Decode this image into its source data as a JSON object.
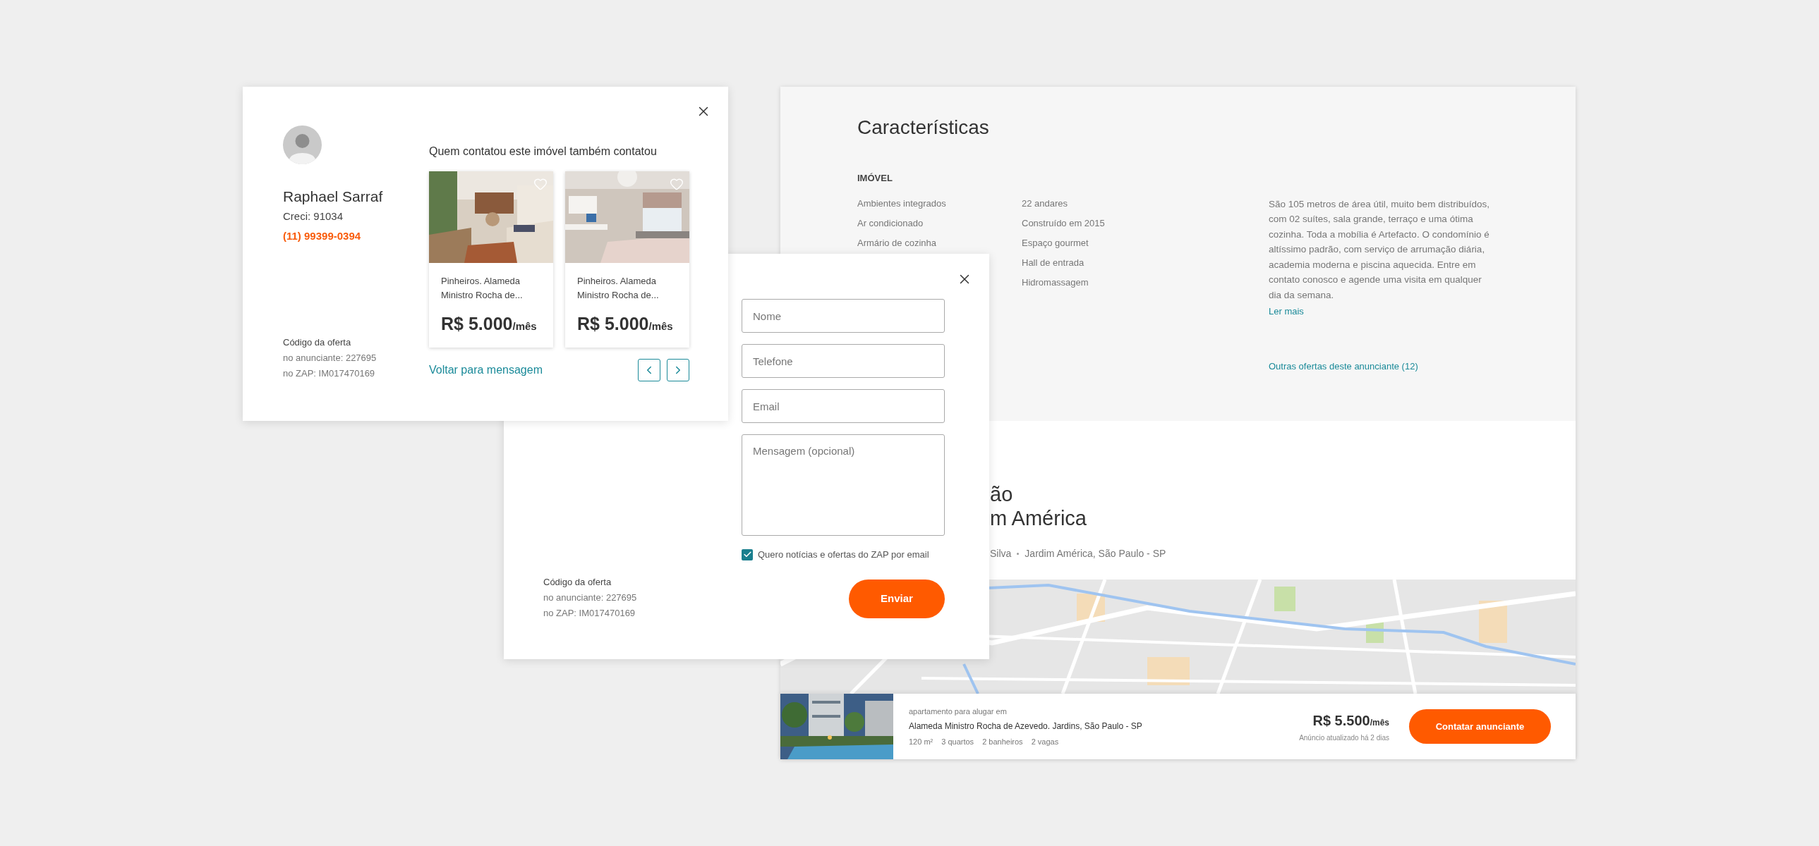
{
  "contact_modal": {
    "agent": {
      "name": "Raphael Sarraf",
      "creci": "Creci: 91034",
      "phone": "(11) 99399-0394"
    },
    "offer_code": {
      "title": "Código da oferta",
      "lines": [
        "no anunciante: 227695",
        "no ZAP: IM017470169"
      ]
    },
    "recommendations_title": "Quem contatou este imóvel também contatou",
    "listings": [
      {
        "address": "Pinheiros. Alameda Ministro Rocha de...",
        "price": "R$ 5.000",
        "period": "/mês",
        "kind": "living"
      },
      {
        "address": "Pinheiros. Alameda Ministro Rocha de...",
        "price": "R$ 5.000",
        "period": "/mês",
        "kind": "bedroom"
      }
    ],
    "back_link": "Voltar para mensagem"
  },
  "form_modal": {
    "fields": [
      {
        "kind": "input",
        "placeholder": "Nome"
      },
      {
        "kind": "input",
        "placeholder": "Telefone"
      },
      {
        "kind": "input",
        "placeholder": "Email"
      },
      {
        "kind": "textarea",
        "placeholder": "Mensagem (opcional)"
      }
    ],
    "newsletter": {
      "label": "Quero notícias e ofertas do ZAP por email",
      "checked": true
    },
    "submit": "Enviar",
    "offer_code": {
      "title": "Código da oferta",
      "lines": [
        "no anunciante: 227695",
        "no ZAP: IM017470169"
      ]
    }
  },
  "property_page": {
    "section_title": "Características",
    "group_title": "IMÓVEL",
    "features_col1": [
      "Ambientes integrados",
      "Ar condicionado",
      "Armário de cozinha"
    ],
    "features_col2": [
      "22 andares",
      "Construído em 2015",
      "Espaço gourmet",
      "Hall de entrada",
      "Hidromassagem"
    ],
    "description": "São 105 metros de área útil, muito bem distribuídos, com 02 suítes, sala grande, terraço e uma ótima cozinha. Toda a mobília é Artefacto. O condomínio é altíssimo padrão, com serviço de arrumação diária, academia moderna e piscina aquecida. Entre em contato conosco e agende uma visita em qualquer dia da semana.",
    "read_more": "Ler mais",
    "other_offers": "Outras ofertas deste anunciante (12)",
    "location_title_lines": [
      "ão",
      "m América"
    ],
    "address_parts": [
      "Silva",
      "Jardim América, São Paulo - SP"
    ],
    "listing_bar": {
      "type_label": "apartamento para alugar em",
      "address": "Alameda Ministro Rocha de Azevedo. Jardins, São Paulo - SP",
      "specs": [
        "120 m²",
        "3 quartos",
        "2 banheiros",
        "2 vagas"
      ],
      "price": "R$ 5.500",
      "period": "/mês",
      "updated": "Anúncio atualizado há 2 dias",
      "cta": "Contatar anunciante"
    }
  }
}
